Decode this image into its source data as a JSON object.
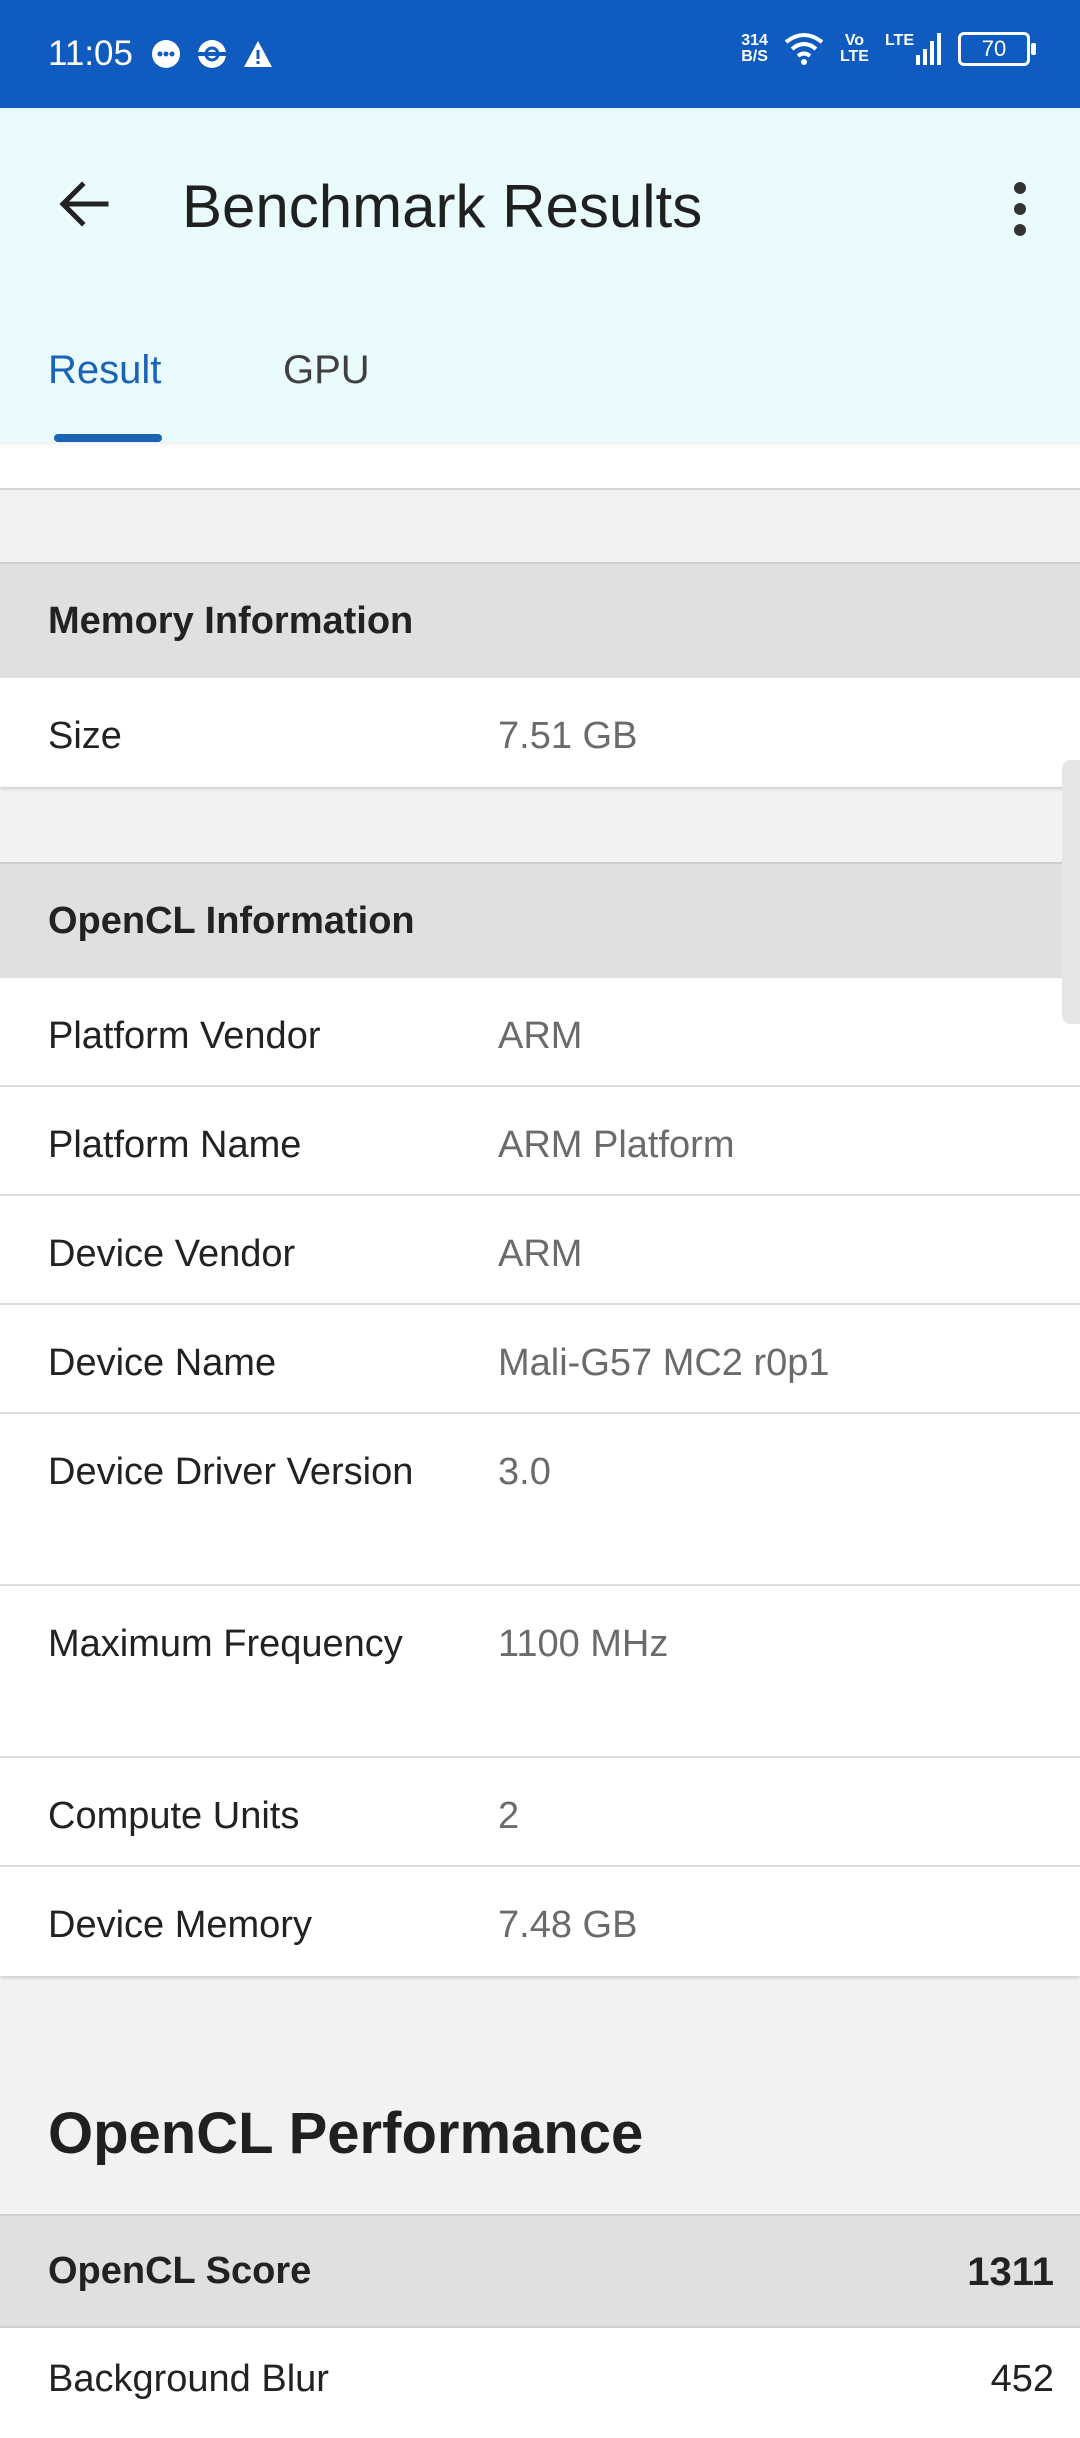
{
  "status_bar": {
    "time": "11:05",
    "net_speed_top": "314",
    "net_speed_bottom": "B/S",
    "volte_top": "Vo",
    "volte_bottom": "LTE",
    "lte_label": "LTE",
    "battery": "70"
  },
  "app_bar": {
    "title": "Benchmark Results"
  },
  "tabs": [
    {
      "label": "Result",
      "selected": true
    },
    {
      "label": "GPU",
      "selected": false
    }
  ],
  "memory_section": {
    "header": "Memory Information",
    "rows": [
      {
        "label": "Size",
        "value": "7.51 GB"
      }
    ]
  },
  "opencl_section": {
    "header": "OpenCL Information",
    "rows": [
      {
        "label": "Platform Vendor",
        "value": "ARM"
      },
      {
        "label": "Platform Name",
        "value": "ARM Platform"
      },
      {
        "label": "Device Vendor",
        "value": "ARM"
      },
      {
        "label": "Device Name",
        "value": "Mali-G57 MC2 r0p1"
      },
      {
        "label": "Device Driver Version",
        "value": "3.0"
      },
      {
        "label": "Maximum Frequency",
        "value": "1100 MHz"
      },
      {
        "label": "Compute Units",
        "value": "2"
      },
      {
        "label": "Device Memory",
        "value": "7.48 GB"
      }
    ]
  },
  "performance": {
    "title": "OpenCL Performance",
    "score_label": "OpenCL Score",
    "score_value": "1311",
    "tests": [
      {
        "label": "Background Blur",
        "value": "452"
      }
    ]
  },
  "colors": {
    "status_bar": "#0f5bbf",
    "app_bar": "#e9fbfd",
    "accent": "#1a63b5"
  }
}
